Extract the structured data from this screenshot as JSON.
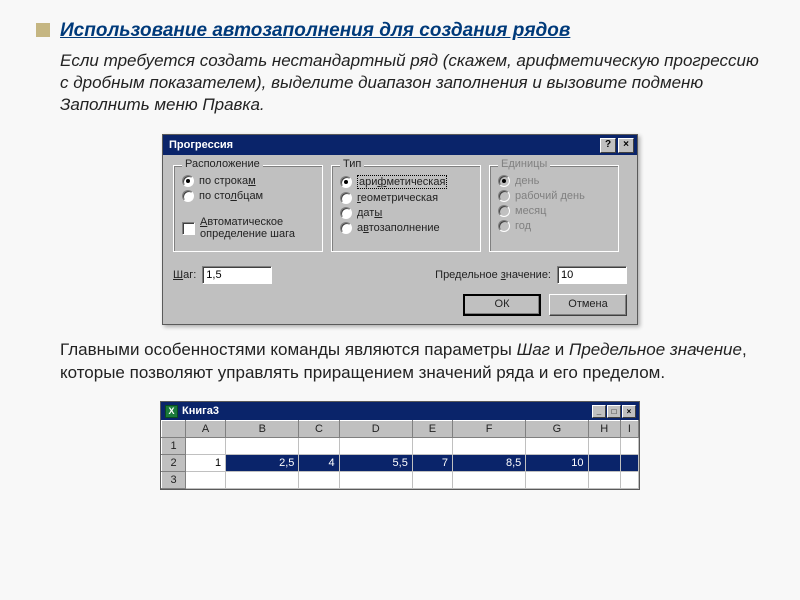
{
  "page": {
    "title": "Использование автозаполнения для создания рядов",
    "intro": "Если требуется создать нестандартный ряд (скажем, арифметическую прогрессию с дробным показателем), выделите диапазон заполнения и вызовите подменю Заполнить меню Правка.",
    "outro_pre": "Главными особенностями команды являются параметры ",
    "outro_em1": "Шаг",
    "outro_mid": " и ",
    "outro_em2": "Предельное значение",
    "outro_post": ", которые позволяют управлять приращением значений ряда и его пределом."
  },
  "dialog": {
    "title": "Прогрессия",
    "groups": {
      "layout": {
        "legend": "Расположение",
        "by_rows": "по строкам",
        "by_cols": "по столбцам"
      },
      "type": {
        "legend": "Тип",
        "arith": "арифметическая",
        "geom": "геометрическая",
        "dates": "даты",
        "autofill": "автозаполнение"
      },
      "units": {
        "legend": "Единицы",
        "day": "день",
        "workday": "рабочий день",
        "month": "месяц",
        "year": "год"
      }
    },
    "auto_step": "Автоматическое определение шага",
    "step_label": "Шаг:",
    "step_value": "1,5",
    "limit_label": "Предельное значение:",
    "limit_value": "10",
    "ok": "ОК",
    "cancel": "Отмена"
  },
  "sheet": {
    "title": "Книга3",
    "cols": [
      "A",
      "B",
      "C",
      "D",
      "E",
      "F",
      "G",
      "H",
      "I"
    ],
    "row1": [
      "1",
      "2,5",
      "4",
      "5,5",
      "7",
      "8,5",
      "10",
      "",
      ""
    ]
  }
}
